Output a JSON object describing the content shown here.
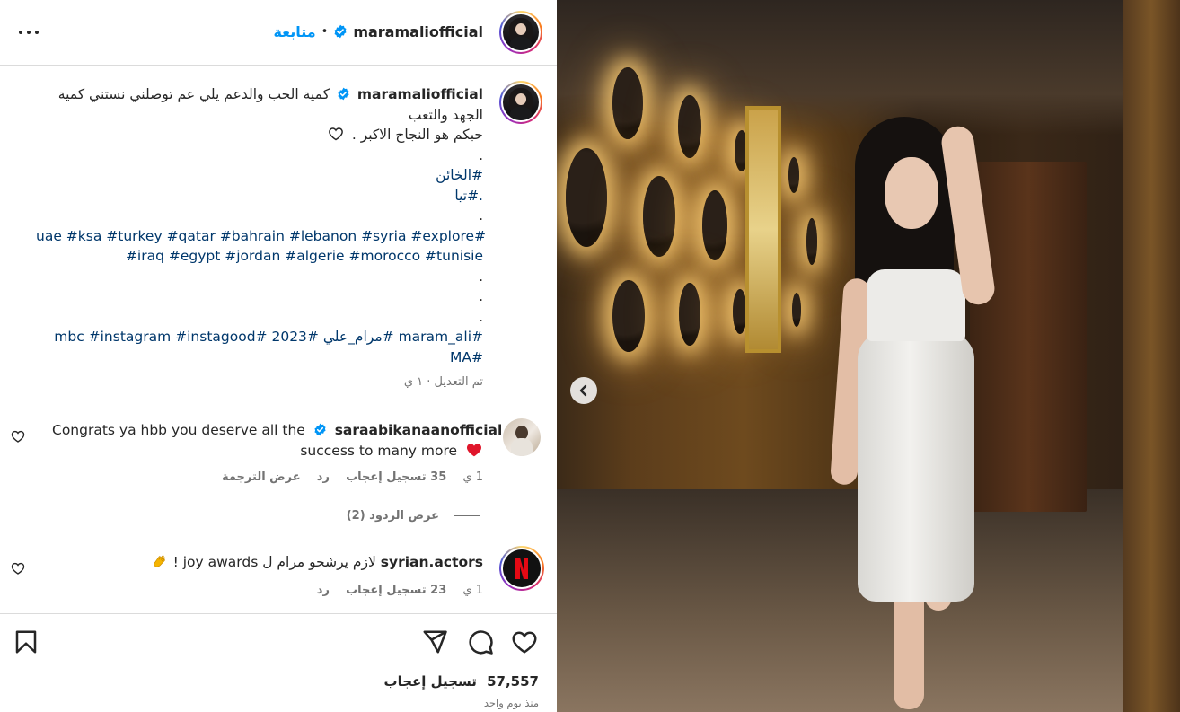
{
  "header": {
    "username": "maramaliofficial",
    "separator": "•",
    "follow_label": "متابعة",
    "more_icon": "more-horizontal-icon"
  },
  "caption": {
    "username": "maramaliofficial",
    "line1": "كمية الحب والدعم يلي عم توصلني نستني كمية",
    "line2": "الجهد والتعب",
    "line3": "حبكم هو النجاح الاكبر .",
    "heart_icon": "heart-outline-icon",
    "dot1": ".",
    "tag_khaen": "#الخائن",
    "tag_tia": ".#تيا",
    "dot2": ".",
    "tags_row1": "uae #ksa #turkey #qatar #bahrain #lebanon #syria #explore#",
    "tags_row2": "#iraq #egypt #jordan #algerie #morocco #tunisie",
    "dot3": ".",
    "dot4": ".",
    "dot5": ".",
    "tags_row3": "mbc #instagram #instagood# 2023# مرام_علي# maram_ali#",
    "tags_row4": "MA#",
    "meta": "تم التعديل · ١ ي"
  },
  "comments": [
    {
      "username": "saraabikanaanofficial",
      "text_a": "Congrats ya hbb you deserve all the",
      "text_b": "success to many more",
      "time": "1 ي",
      "likes": "35 تسجيل إعجاب",
      "reply": "رد",
      "translate": "عرض الترجمة"
    },
    {
      "username": "syrian.actors",
      "text_a": "لازم يرشحو مرام ل joy awards !",
      "time": "1 ي",
      "likes": "23 تسجيل إعجاب",
      "reply": "رد"
    }
  ],
  "replies_toggle": "عرض الردود (2)",
  "actions": {
    "like_icon": "heart-outline-icon",
    "comment_icon": "comment-icon",
    "share_icon": "send-icon",
    "save_icon": "bookmark-icon"
  },
  "likes": {
    "count": "57,557",
    "label": "تسجيل إعجاب"
  },
  "time_ago": "منذ يوم واحد",
  "colors": {
    "link": "#00376b",
    "verified": "#0095f6",
    "follow": "#0095f6",
    "muted": "#737373"
  }
}
